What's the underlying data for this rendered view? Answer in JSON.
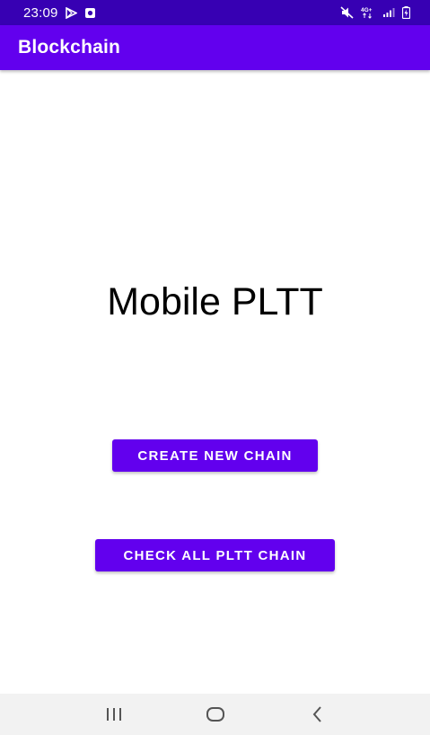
{
  "status_bar": {
    "time": "23:09",
    "icons_left": [
      "play-store-icon",
      "screenshot-icon"
    ],
    "icons_right": [
      "mute-icon",
      "network-4g-icon",
      "signal-icon",
      "battery-icon"
    ],
    "network_label": "4G+"
  },
  "app_bar": {
    "title": "Blockchain"
  },
  "main": {
    "heading": "Mobile PLTT",
    "buttons": {
      "create_label": "CREATE NEW CHAIN",
      "check_label": "CHECK ALL PLTT CHAIN"
    }
  },
  "nav_bar": {
    "icons": [
      "recents-icon",
      "home-icon",
      "back-icon"
    ]
  },
  "colors": {
    "status_bar": "#3700b3",
    "primary": "#6200ee",
    "nav_bar": "#f2f2f2"
  }
}
